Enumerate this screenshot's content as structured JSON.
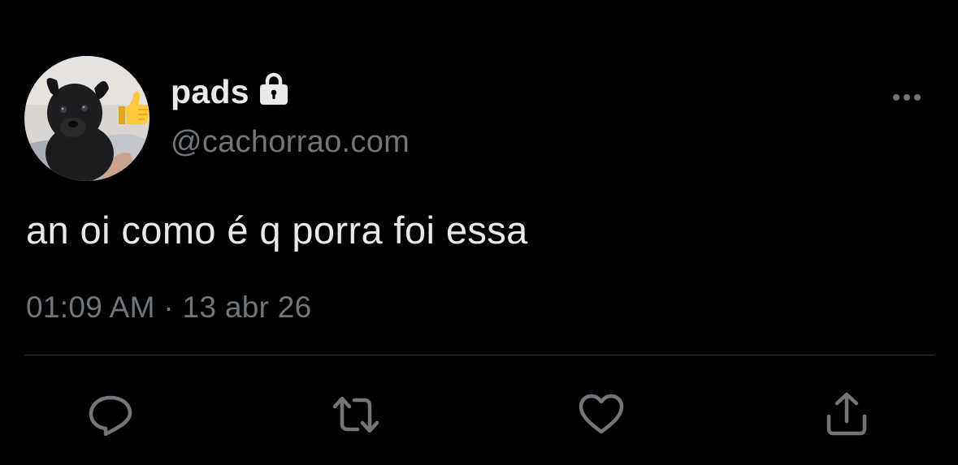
{
  "tweet": {
    "author": {
      "display_name": "pads",
      "handle": "@cachorrao.com",
      "protected": true,
      "avatar_description": "black puppy with thumbs-up emoji"
    },
    "text": "an oi como é q porra foi essa",
    "time": "01:09 AM",
    "separator": " · ",
    "date": "13 abr 26"
  },
  "actions": [
    {
      "icon": "reply-icon"
    },
    {
      "icon": "retweet-icon"
    },
    {
      "icon": "heart-icon"
    },
    {
      "icon": "share-icon"
    }
  ],
  "colors": {
    "background": "#000000",
    "primary_text": "#e7e9ea",
    "secondary_text": "#71767b",
    "divider": "#2f3336"
  }
}
